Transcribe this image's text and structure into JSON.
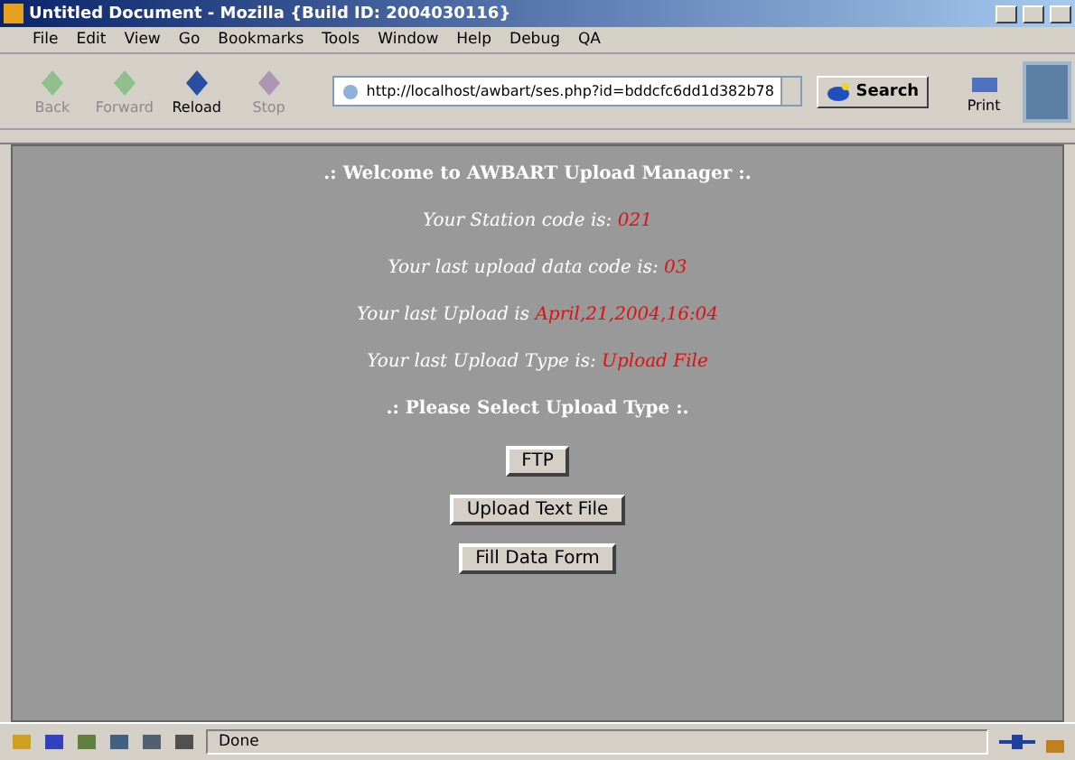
{
  "window": {
    "title": "Untitled Document - Mozilla {Build ID: 2004030116}"
  },
  "menu": [
    "File",
    "Edit",
    "View",
    "Go",
    "Bookmarks",
    "Tools",
    "Window",
    "Help",
    "Debug",
    "QA"
  ],
  "nav_buttons": [
    {
      "label": "Back",
      "disabled": true,
      "kind": "back"
    },
    {
      "label": "Forward",
      "disabled": true,
      "kind": "forward"
    },
    {
      "label": "Reload",
      "disabled": false,
      "kind": "reload"
    },
    {
      "label": "Stop",
      "disabled": true,
      "kind": "stop"
    }
  ],
  "address": {
    "value": "http://localhost/awbart/ses.php?id=bddcfc6dd1d382b78"
  },
  "search_button": "Search",
  "print_button": "Print",
  "page": {
    "heading": ".: Welcome to AWBART Upload Manager :.",
    "info": [
      {
        "label": "Your Station code is:",
        "value": "021"
      },
      {
        "label": "Your last upload data code is:",
        "value": "03"
      },
      {
        "label": "Your last Upload is",
        "value": "April,21,2004,16:04"
      },
      {
        "label": "Your last Upload Type is:",
        "value": "Upload File"
      }
    ],
    "prompt": ".: Please Select Upload Type :.",
    "buttons": [
      "FTP",
      "Upload Text File",
      "Fill Data Form"
    ]
  },
  "status_bar": {
    "text": "Done"
  }
}
